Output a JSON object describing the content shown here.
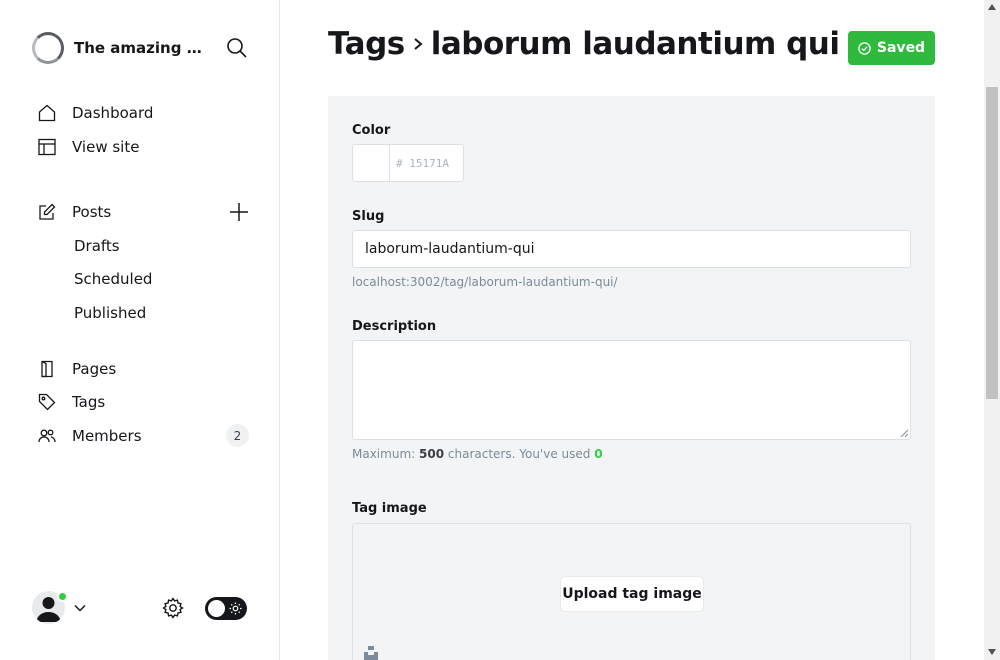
{
  "sidebar": {
    "site_title": "The amazing wo...",
    "nav": {
      "dashboard": "Dashboard",
      "view_site": "View site",
      "posts": "Posts",
      "drafts": "Drafts",
      "scheduled": "Scheduled",
      "published": "Published",
      "pages": "Pages",
      "tags": "Tags",
      "members": "Members",
      "members_count": "2"
    }
  },
  "header": {
    "breadcrumb_parent": "Tags",
    "breadcrumb_current": "laborum laudantium qui",
    "saved_label": "Saved"
  },
  "form": {
    "color_label": "Color",
    "color_value": "# 15171A",
    "slug_label": "Slug",
    "slug_value": "laborum-laudantium-qui",
    "slug_url": "localhost:3002/tag/laborum-laudantium-qui/",
    "description_label": "Description",
    "description_value": "",
    "hint_prefix": "Maximum:",
    "hint_max": "500",
    "hint_middle": "characters. You've used",
    "hint_used": "0",
    "tag_image_label": "Tag image",
    "upload_label": "Upload tag image"
  },
  "colors": {
    "accent_green": "#30cf43",
    "text_dark": "#15171a",
    "panel_bg": "#f3f4f5"
  },
  "icons": [
    "brand-logo",
    "search-icon",
    "home-icon",
    "layout-icon",
    "edit-icon",
    "plus-icon",
    "page-icon",
    "tag-icon",
    "members-icon",
    "avatar",
    "chevron-down-icon",
    "gear-icon",
    "sun-icon",
    "check-circle-icon",
    "unsplash-icon"
  ]
}
